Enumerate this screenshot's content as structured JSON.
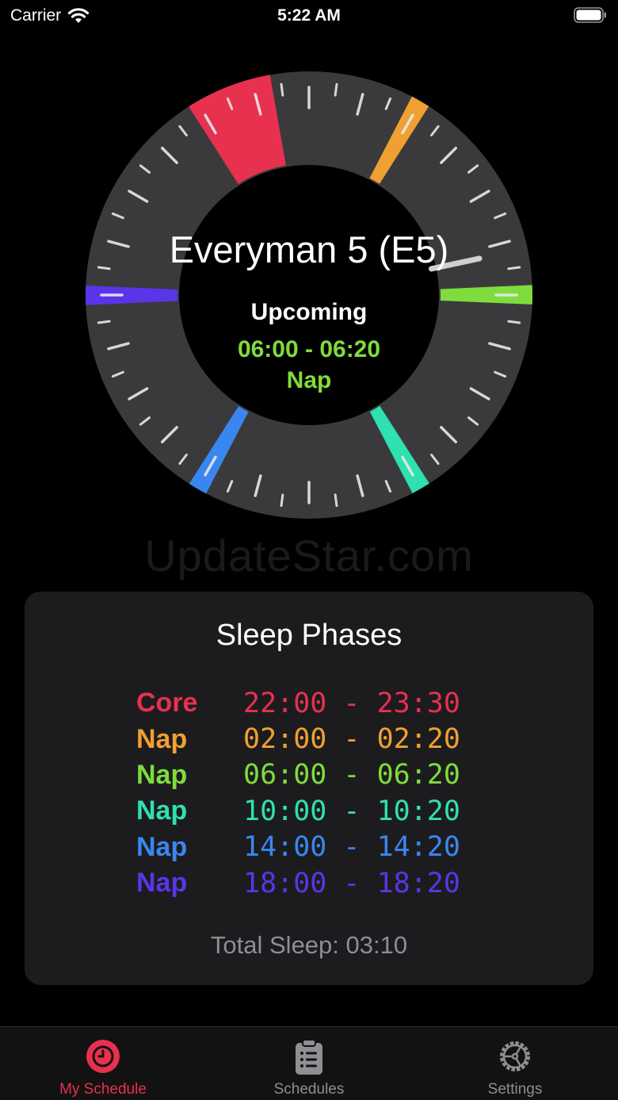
{
  "status_bar": {
    "carrier": "Carrier",
    "time": "5:22 AM"
  },
  "dial": {
    "title": "Everyman 5 (E5)",
    "upcoming_label": "Upcoming",
    "upcoming_time": "06:00 - 06:20",
    "upcoming_type": "Nap",
    "upcoming_color": "#7fdc3c",
    "ring_color": "#3a3a3c",
    "segments": [
      {
        "start": "22:00",
        "end": "23:30",
        "color": "#e8304f"
      },
      {
        "start": "02:00",
        "end": "02:20",
        "color": "#f0a030"
      },
      {
        "start": "06:00",
        "end": "06:20",
        "color": "#7fdc3c"
      },
      {
        "start": "10:00",
        "end": "10:20",
        "color": "#2fe0b0"
      },
      {
        "start": "14:00",
        "end": "14:20",
        "color": "#3a86f0"
      },
      {
        "start": "18:00",
        "end": "18:20",
        "color": "#5a35e8"
      }
    ],
    "current_time": "5:22"
  },
  "watermark": "UpdateStar.com",
  "sleep_phases": {
    "title": "Sleep Phases",
    "phases": [
      {
        "name": "Core",
        "time": "22:00 - 23:30",
        "color": "#e8304f"
      },
      {
        "name": "Nap",
        "time": "02:00 - 02:20",
        "color": "#f0a030"
      },
      {
        "name": "Nap",
        "time": "06:00 - 06:20",
        "color": "#7fdc3c"
      },
      {
        "name": "Nap",
        "time": "10:00 - 10:20",
        "color": "#2fe0b0"
      },
      {
        "name": "Nap",
        "time": "14:00 - 14:20",
        "color": "#3a86f0"
      },
      {
        "name": "Nap",
        "time": "18:00 - 18:20",
        "color": "#5a35e8"
      }
    ],
    "total_sleep": "Total Sleep: 03:10"
  },
  "tab_bar": {
    "accent_color": "#e8304f",
    "tabs": [
      {
        "label": "My Schedule",
        "icon": "clock-icon",
        "active": true
      },
      {
        "label": "Schedules",
        "icon": "clipboard-icon",
        "active": false
      },
      {
        "label": "Settings",
        "icon": "gear-icon",
        "active": false
      }
    ]
  }
}
